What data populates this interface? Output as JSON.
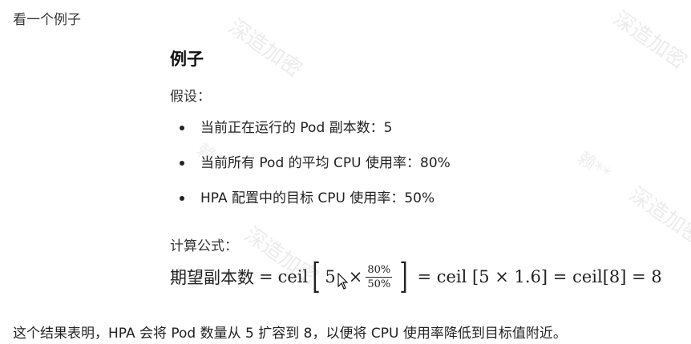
{
  "intro": "看一个例子",
  "heading": "例子",
  "assume_label": "假设：",
  "assumptions": [
    "当前正在运行的 Pod 副本数：5",
    "当前所有 Pod 的平均 CPU 使用率：80%",
    "HPA 配置中的目标 CPU 使用率：50%"
  ],
  "formula_label": "计算公式：",
  "formula": {
    "lhs": "期望副本数",
    "eq": "=",
    "ceil": "ceil",
    "replicas": "5",
    "times": "×",
    "num": "80%",
    "den": "50%",
    "part2": "= ceil [5 × 1.6] = ceil[8] = 8"
  },
  "conclusion": "这个结果表明，HPA 会将 Pod 数量从 5 扩容到 8，以便将 CPU 使用率降低到目标值附近。",
  "watermark": "深造加密",
  "watermark_user": "赖**"
}
